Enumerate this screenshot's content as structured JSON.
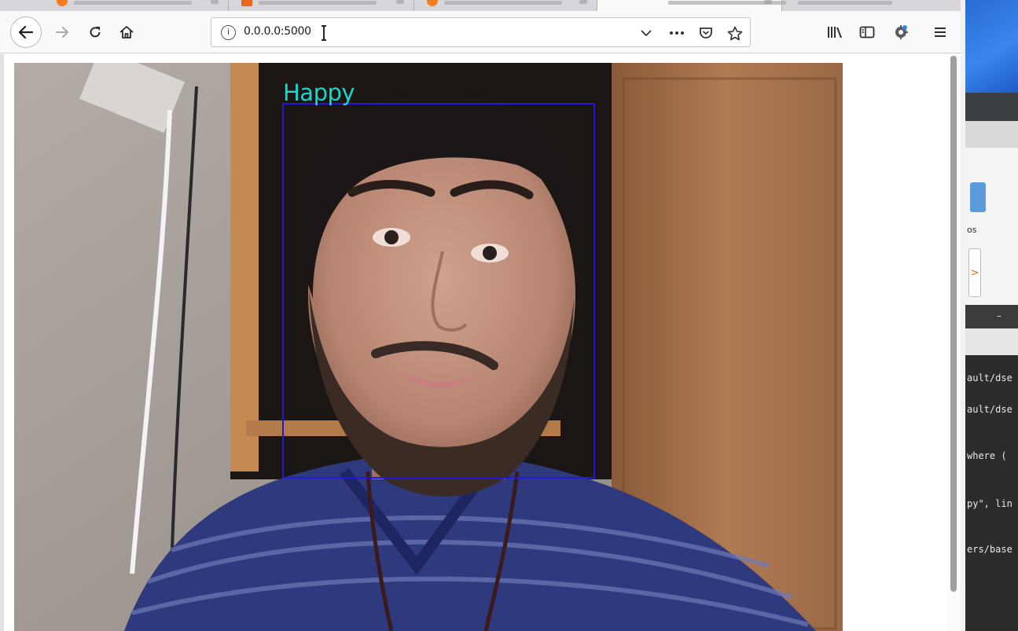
{
  "browser": {
    "url": "0.0.0.0:5000",
    "tabs": [
      {
        "favicon": "firefox-icon"
      },
      {
        "favicon": "document-icon"
      },
      {
        "favicon": "firefox-icon"
      },
      {
        "favicon": "none",
        "active": true
      },
      {
        "favicon": "none"
      }
    ],
    "icons": {
      "back": "back-arrow-icon",
      "forward": "forward-arrow-icon",
      "reload": "reload-icon",
      "home": "home-icon",
      "info": "info-icon",
      "dropdown": "chevron-down-icon",
      "more": "ellipsis-icon",
      "pocket": "pocket-icon",
      "bookmark": "star-icon",
      "library": "library-icon",
      "sidebar": "sidebar-icon",
      "extension": "extension-icon",
      "menu": "hamburger-menu-icon"
    }
  },
  "video": {
    "emotion_label": "Happy",
    "box_color": "#2318d8",
    "label_color": "#19d6cc"
  },
  "desktop": {
    "panel_text": "os",
    "terminal_title": "–",
    "terminal_lines": [
      "ault/dse",
      "ault/dse",
      " where (",
      "py\", lin",
      "ers/base"
    ]
  }
}
